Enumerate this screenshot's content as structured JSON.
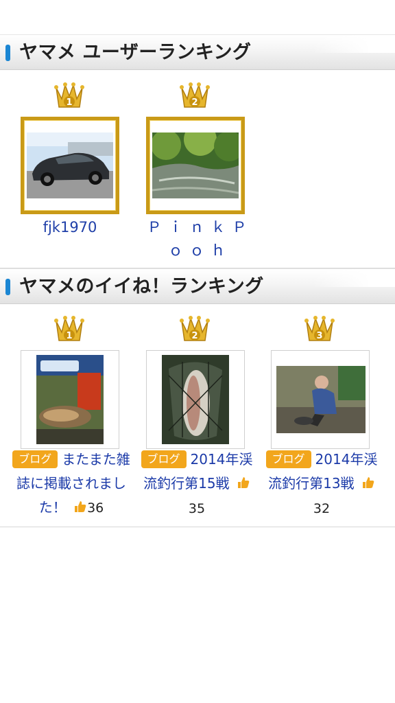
{
  "user_ranking": {
    "title": "ヤマメ ユーザーランキング",
    "items": [
      {
        "rank": "1",
        "name": "fjk1970"
      },
      {
        "rank": "2",
        "name": "ＰｉｎｋＰｏｏｈ"
      }
    ]
  },
  "like_ranking": {
    "title": "ヤマメのイイね！ランキング",
    "items": [
      {
        "rank": "1",
        "tag": "ブログ",
        "text": "またまた雑誌に掲載されました！",
        "likes": "36"
      },
      {
        "rank": "2",
        "tag": "ブログ",
        "text": "2014年渓流釣行第15戦",
        "likes": "35"
      },
      {
        "rank": "3",
        "tag": "ブログ",
        "text": "2014年渓流釣行第13戦",
        "likes": "32"
      }
    ]
  },
  "colors": {
    "accent": "#1b86d3",
    "gold": "#c99a17",
    "tag": "#f2a61c",
    "link": "#1b3aa8"
  }
}
